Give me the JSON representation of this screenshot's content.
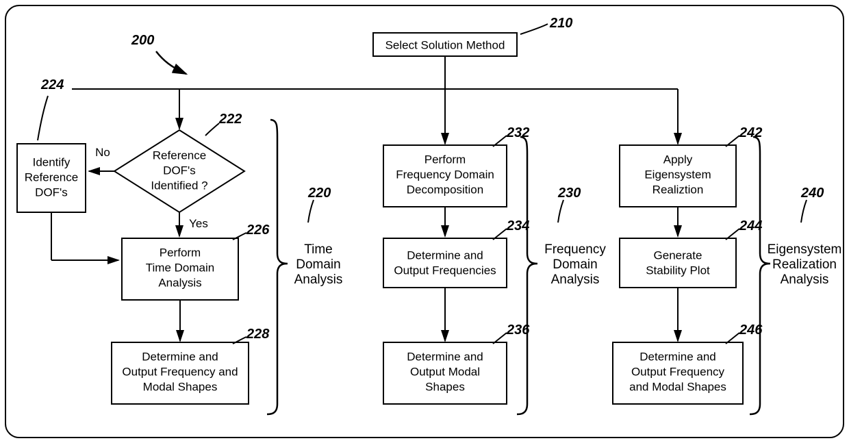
{
  "refs": {
    "r200": "200",
    "r210": "210",
    "r220": "220",
    "r222": "222",
    "r224": "224",
    "r226": "226",
    "r228": "228",
    "r230": "230",
    "r232": "232",
    "r234": "234",
    "r236": "236",
    "r240": "240",
    "r242": "242",
    "r244": "244",
    "r246": "246"
  },
  "boxes": {
    "b210": "Select Solution Method",
    "b224_l1": "Identify",
    "b224_l2": "Reference",
    "b224_l3": "DOF's",
    "b222_l1": "Reference",
    "b222_l2": "DOF's",
    "b222_l3": "Identified ?",
    "b226_l1": "Perform",
    "b226_l2": "Time Domain",
    "b226_l3": "Analysis",
    "b228_l1": "Determine and",
    "b228_l2": "Output Frequency and",
    "b228_l3": "Modal Shapes",
    "b232_l1": "Perform",
    "b232_l2": "Frequency Domain",
    "b232_l3": "Decomposition",
    "b234_l1": "Determine and",
    "b234_l2": "Output Frequencies",
    "b236_l1": "Determine and",
    "b236_l2": "Output Modal",
    "b236_l3": "Shapes",
    "b242_l1": "Apply",
    "b242_l2": "Eigensystem",
    "b242_l3": "Realiztion",
    "b244_l1": "Generate",
    "b244_l2": "Stability Plot",
    "b246_l1": "Determine and",
    "b246_l2": "Output Frequency",
    "b246_l3": "and Modal Shapes"
  },
  "groupLabels": {
    "g220_l1": "Time",
    "g220_l2": "Domain",
    "g220_l3": "Analysis",
    "g230_l1": "Frequency",
    "g230_l2": "Domain",
    "g230_l3": "Analysis",
    "g240_l1": "Eigensystem",
    "g240_l2": "Realization",
    "g240_l3": "Analysis"
  },
  "edges": {
    "no": "No",
    "yes": "Yes"
  }
}
